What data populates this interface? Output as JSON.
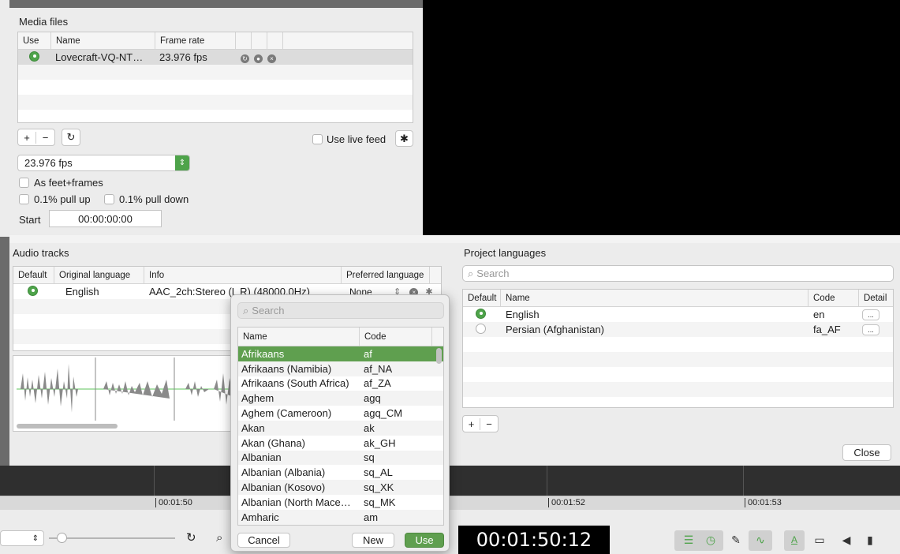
{
  "media": {
    "title": "Media files",
    "columns": [
      "Use",
      "Name",
      "Frame rate"
    ],
    "rows": [
      {
        "name": "Lovecraft-VQ-NT…",
        "frame_rate": "23.976 fps"
      }
    ],
    "add_label": "+",
    "remove_label": "−",
    "refresh_icon": "refresh-icon",
    "use_live_feed_label": "Use live feed",
    "fps_select_value": "23.976 fps",
    "as_feet_frames_label": "As feet+frames",
    "pull_up_label": "0.1% pull up",
    "pull_down_label": "0.1% pull down",
    "start_label": "Start",
    "start_value": "00:00:00:00"
  },
  "audio": {
    "title": "Audio tracks",
    "columns": [
      "Default",
      "Original language",
      "Info",
      "Preferred language"
    ],
    "row": {
      "language": "English",
      "info": "AAC_2ch:Stereo (L R) (48000.0Hz)",
      "preferred": "None"
    }
  },
  "popover": {
    "search_placeholder": "Search",
    "columns": [
      "Name",
      "Code"
    ],
    "items": [
      {
        "name": "Afrikaans",
        "code": "af"
      },
      {
        "name": "Afrikaans (Namibia)",
        "code": "af_NA"
      },
      {
        "name": "Afrikaans (South Africa)",
        "code": "af_ZA"
      },
      {
        "name": "Aghem",
        "code": "agq"
      },
      {
        "name": "Aghem (Cameroon)",
        "code": "agq_CM"
      },
      {
        "name": "Akan",
        "code": "ak"
      },
      {
        "name": "Akan (Ghana)",
        "code": "ak_GH"
      },
      {
        "name": "Albanian",
        "code": "sq"
      },
      {
        "name": "Albanian (Albania)",
        "code": "sq_AL"
      },
      {
        "name": "Albanian (Kosovo)",
        "code": "sq_XK"
      },
      {
        "name": "Albanian (North Mace…",
        "code": "sq_MK"
      },
      {
        "name": "Amharic",
        "code": "am"
      }
    ],
    "cancel_label": "Cancel",
    "new_label": "New",
    "use_label": "Use"
  },
  "languages": {
    "title": "Project languages",
    "search_placeholder": "Search",
    "columns": [
      "Default",
      "Name",
      "Code",
      "Detail"
    ],
    "rows": [
      {
        "name": "English",
        "code": "en",
        "detail": "..."
      },
      {
        "name": "Persian (Afghanistan)",
        "code": "fa_AF",
        "detail": "..."
      }
    ],
    "add_label": "+",
    "remove_label": "−",
    "close_label": "Close"
  },
  "timeline": {
    "ruler_labels": [
      "00:01:50",
      "00:01:52",
      "00:01:53"
    ],
    "timecode": "00:01:50:12"
  },
  "colors": {
    "accent_green": "#4ea34a",
    "selection_green": "#5f9f4f",
    "video_bg": "#000000"
  }
}
